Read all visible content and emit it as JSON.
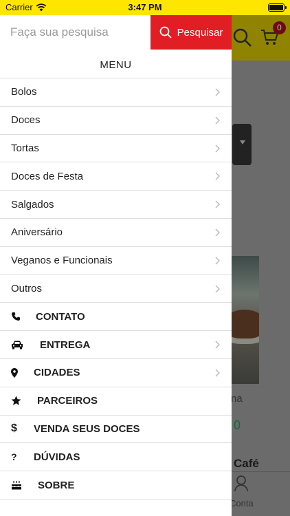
{
  "status_bar": {
    "carrier": "Carrier",
    "time": "3:47 PM"
  },
  "background": {
    "cart_count": "0",
    "product_name_partial": "na",
    "price_partial": "0",
    "section_partial": "Café",
    "tab_conta_partial": "Conta"
  },
  "drawer": {
    "search": {
      "placeholder": "Faça sua pesquisa",
      "button_label": "Pesquisar"
    },
    "menu_title": "MENU",
    "categories": [
      {
        "label": "Bolos"
      },
      {
        "label": "Doces"
      },
      {
        "label": "Tortas"
      },
      {
        "label": "Doces de Festa"
      },
      {
        "label": "Salgados"
      },
      {
        "label": "Aniversário"
      },
      {
        "label": "Veganos e Funcionais"
      },
      {
        "label": "Outros"
      }
    ],
    "links": [
      {
        "label": "CONTATO",
        "icon": "phone-icon"
      },
      {
        "label": "ENTREGA",
        "icon": "car-icon"
      },
      {
        "label": "CIDADES",
        "icon": "map-marker-icon"
      },
      {
        "label": "PARCEIROS",
        "icon": "star-icon"
      },
      {
        "label": "VENDA SEUS DOCES",
        "icon": "dollar-icon"
      },
      {
        "label": "DÚVIDAS",
        "icon": "question-icon"
      },
      {
        "label": "SOBRE",
        "icon": "birthday-cake-icon"
      }
    ]
  },
  "colors": {
    "status_bar": "#ffe600",
    "search_button": "#e01e24",
    "price": "#0d6b3f"
  }
}
